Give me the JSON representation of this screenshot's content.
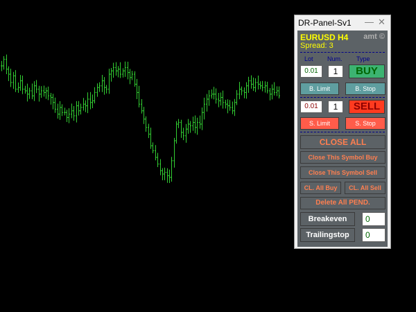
{
  "chart": {
    "bar_color": "#32cd32",
    "y_range": [
      0,
      1
    ],
    "series": [
      0.75,
      0.79,
      0.73,
      0.7,
      0.65,
      0.69,
      0.61,
      0.62,
      0.66,
      0.61,
      0.6,
      0.58,
      0.6,
      0.57,
      0.63,
      0.61,
      0.58,
      0.6,
      0.59,
      0.6,
      0.57,
      0.56,
      0.53,
      0.49,
      0.46,
      0.5,
      0.47,
      0.47,
      0.44,
      0.46,
      0.48,
      0.45,
      0.51,
      0.48,
      0.5,
      0.52,
      0.51,
      0.55,
      0.53,
      0.54,
      0.59,
      0.62,
      0.63,
      0.66,
      0.62,
      0.61,
      0.7,
      0.72,
      0.74,
      0.72,
      0.73,
      0.7,
      0.72,
      0.74,
      0.71,
      0.68,
      0.7,
      0.64,
      0.59,
      0.52,
      0.48,
      0.43,
      0.38,
      0.34,
      0.27,
      0.24,
      0.2,
      0.16,
      0.12,
      0.1,
      0.11,
      0.09,
      0.08,
      0.18,
      0.3,
      0.4,
      0.41,
      0.35,
      0.33,
      0.37,
      0.4,
      0.39,
      0.41,
      0.38,
      0.41,
      0.4,
      0.47,
      0.52,
      0.55,
      0.57,
      0.58,
      0.58,
      0.55,
      0.54,
      0.56,
      0.53,
      0.52,
      0.51,
      0.5,
      0.48,
      0.53,
      0.58,
      0.61,
      0.6,
      0.59,
      0.63,
      0.66,
      0.64,
      0.62,
      0.65,
      0.64,
      0.63,
      0.62,
      0.63,
      0.6,
      0.58,
      0.61,
      0.59,
      0.6,
      0.57
    ]
  },
  "panel": {
    "title": "DR-Panel-Sv1",
    "minimize_glyph": "—",
    "close_glyph": "✕",
    "symbol": "EURUSD  H4",
    "brand": "amt ©",
    "spread": "Spread: 3",
    "col_lot": "Lot",
    "col_num": "Num.",
    "col_type": "Type",
    "buy_lot": "0.01",
    "buy_num": "1",
    "buy_label": "BUY",
    "b_limit": "B. Limit",
    "b_stop": "B. Stop",
    "sell_lot": "0.01",
    "sell_num": "1",
    "sell_label": "SELL",
    "s_limit": "S. Limit",
    "s_stop": "S. Stop",
    "close_all": "CLOSE  ALL",
    "close_symbol_buy": "Close This Symbol Buy",
    "close_symbol_sell": "Close This Symbol Sell",
    "cl_all_buy": "CL. All Buy",
    "cl_all_sell": "CL. All Sell",
    "delete_pending": "Delete All PEND.",
    "breakeven": "Breakeven",
    "breakeven_value": "0",
    "trailingstop": "Trailingstop",
    "trailingstop_value": "0"
  }
}
